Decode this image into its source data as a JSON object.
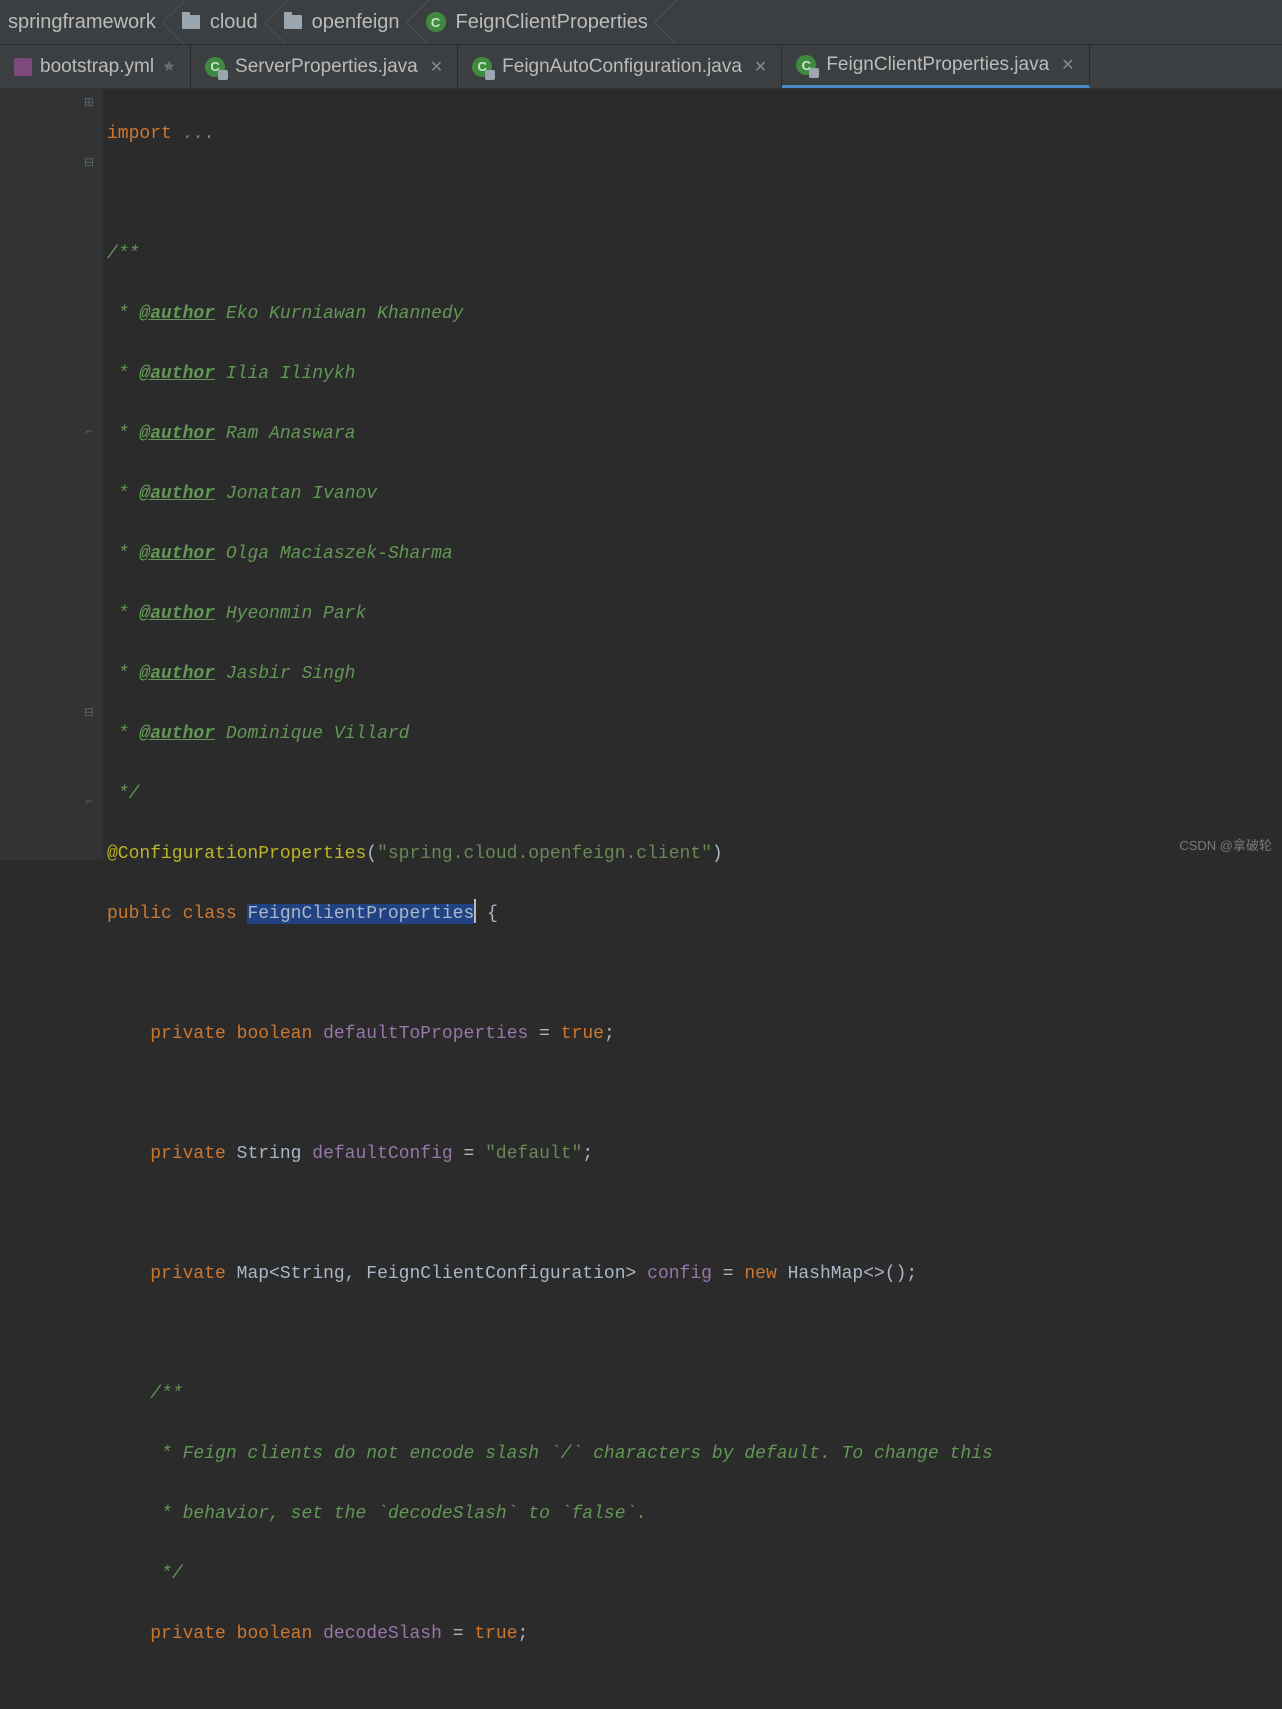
{
  "breadcrumbs": [
    {
      "icon": "none",
      "label": "springframework"
    },
    {
      "icon": "folder",
      "label": "cloud"
    },
    {
      "icon": "folder",
      "label": "openfeign"
    },
    {
      "icon": "class",
      "label": "FeignClientProperties"
    }
  ],
  "tabs": [
    {
      "icon": "yml",
      "label": "bootstrap.yml",
      "pinned": true,
      "active": false
    },
    {
      "icon": "class-lock",
      "label": "ServerProperties.java",
      "closable": true,
      "active": false
    },
    {
      "icon": "class-lock",
      "label": "FeignAutoConfiguration.java",
      "closable": true,
      "active": false
    },
    {
      "icon": "class-lock",
      "label": "FeignClientProperties.java",
      "closable": true,
      "active": true
    }
  ],
  "code": {
    "import_kw": "import",
    "import_ellipsis": "...",
    "doc_open": "/**",
    "author_tag": "@author",
    "authors": [
      "Eko Kurniawan Khannedy",
      "Ilia Ilinykh",
      "Ram Anaswara",
      "Jonatan Ivanov",
      "Olga Maciaszek-Sharma",
      "Hyeonmin Park",
      "Jasbir Singh",
      "Dominique Villard"
    ],
    "doc_close": " */",
    "annotation": "@ConfigurationProperties",
    "annotation_arg": "\"spring.cloud.openfeign.client\"",
    "class_decl_pub": "public",
    "class_decl_class": "class",
    "class_name": "FeignClientProperties",
    "f1_priv": "private",
    "f1_type": "boolean",
    "f1_name": "defaultToProperties",
    "f1_val": "true",
    "f2_type": "String",
    "f2_name": "defaultConfig",
    "f2_val": "\"default\"",
    "f3_type_full": "Map<String, FeignClientConfiguration>",
    "f3_name": "config",
    "f3_new": "new",
    "f3_ctor": "HashMap<>()",
    "doc2_l1": " * Feign clients do not encode slash `/` characters by default. To change this",
    "doc2_l2": " * behavior, set the `decodeSlash` to `false`.",
    "f4_type": "boolean",
    "f4_name": "decodeSlash",
    "f4_val": "true"
  },
  "watermark": "CSDN @拿破轮"
}
